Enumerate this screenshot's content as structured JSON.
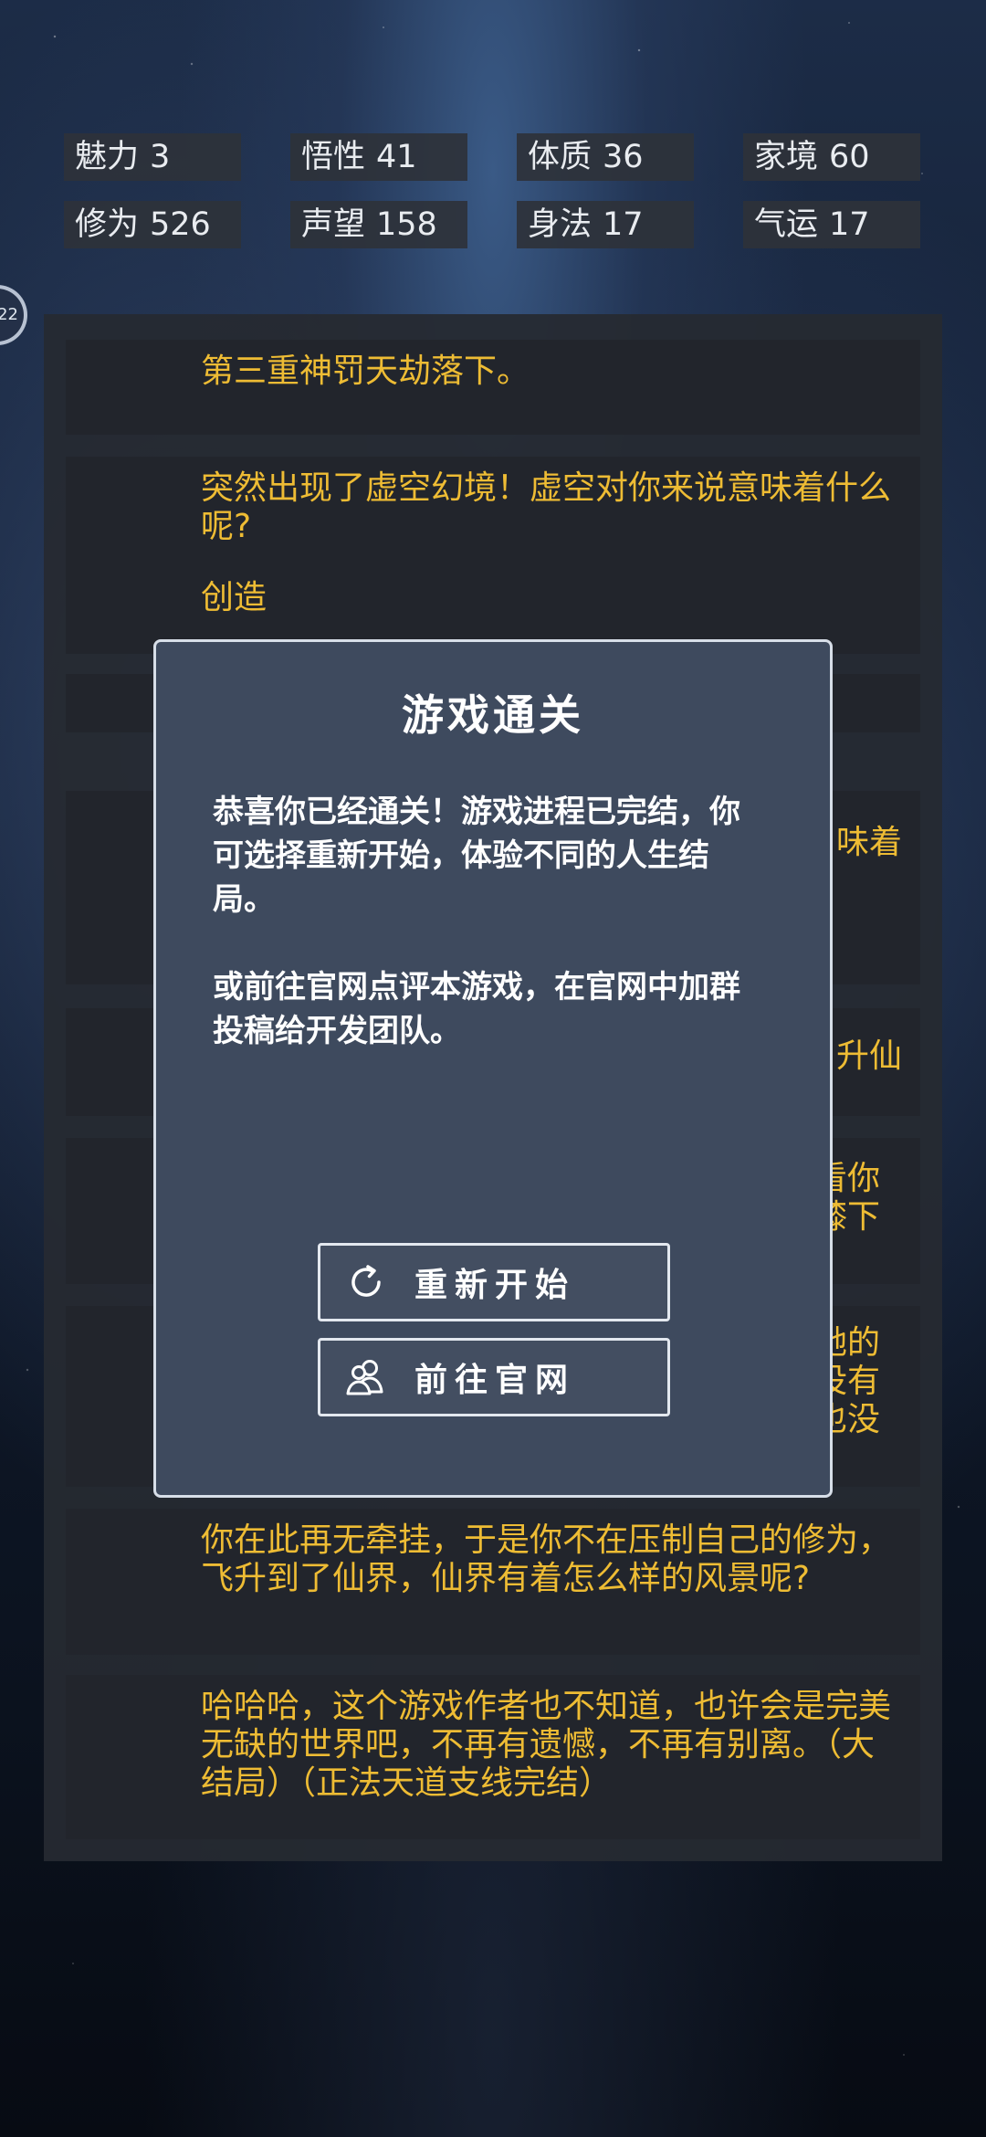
{
  "stats": [
    {
      "label": "魅力",
      "value": "3"
    },
    {
      "label": "悟性",
      "value": "41"
    },
    {
      "label": "体质",
      "value": "36"
    },
    {
      "label": "家境",
      "value": "60"
    },
    {
      "label": "修为",
      "value": "526"
    },
    {
      "label": "声望",
      "value": "158"
    },
    {
      "label": "身法",
      "value": "17"
    },
    {
      "label": "气运",
      "value": "17"
    }
  ],
  "edge_badge": "22",
  "log": [
    {
      "text": "第三重神罚天劫落下。"
    },
    {
      "text": "突然出现了虚空幻境！虚空对你来说意味着什么呢?",
      "option": "创造"
    },
    {
      "text": ""
    },
    {
      "text": "味着"
    },
    {
      "text": "升仙"
    },
    {
      "text": "看你膝下"
    },
    {
      "text": "她的没有也没"
    },
    {
      "text": "你在此再无牵挂，于是你不在压制自己的修为，飞升到了仙界，仙界有着怎么样的风景呢?"
    },
    {
      "text": "哈哈哈，这个游戏作者也不知道，也许会是完美无缺的世界吧，不再有遗憾，不再有别离。（大结局）（正法天道支线完结）"
    }
  ],
  "modal": {
    "title": "游戏通关",
    "paragraph1": "恭喜你已经通关！游戏进程已完结，你可选择重新开始，体验不同的人生结局。",
    "paragraph2": "或前往官网点评本游戏，在官网中加群投稿给开发团队。",
    "restart_label": "重新开始",
    "restart_icon": "refresh-icon",
    "website_label": "前往官网",
    "website_icon": "users-icon"
  }
}
